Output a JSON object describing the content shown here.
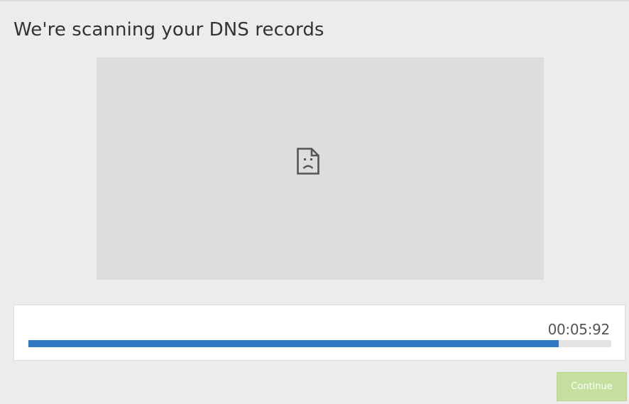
{
  "page": {
    "title": "We're scanning your DNS records"
  },
  "media": {
    "status_icon": "broken-document-icon",
    "background_color": "#dddddd"
  },
  "progress": {
    "timer": "00:05:92",
    "fraction": 0.91,
    "fill_color": "#2d78c0"
  },
  "actions": {
    "continue_label": "Continue",
    "continue_color": "#c5df9e"
  }
}
